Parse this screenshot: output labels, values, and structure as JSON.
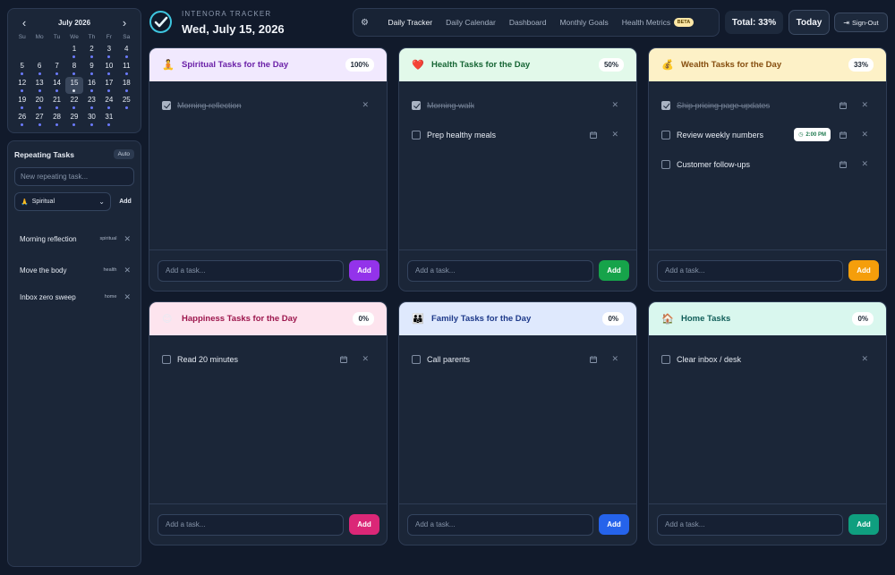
{
  "calendar": {
    "month_label": "July 2026",
    "prev_icon": "chevron-left",
    "next_icon": "chevron-right",
    "weekdays": [
      "Su",
      "Mo",
      "Tu",
      "We",
      "Th",
      "Fr",
      "Sa"
    ],
    "leading_blanks": 3,
    "days": [
      "1",
      "2",
      "3",
      "4",
      "5",
      "6",
      "7",
      "8",
      "9",
      "10",
      "11",
      "12",
      "13",
      "14",
      "15",
      "16",
      "17",
      "18",
      "19",
      "20",
      "21",
      "22",
      "23",
      "24",
      "25",
      "26",
      "27",
      "28",
      "29",
      "30",
      "31"
    ],
    "selected_day": "15"
  },
  "repeating": {
    "title": "Repeating Tasks",
    "auto_label": "Auto",
    "input_placeholder": "New repeating task...",
    "category_select": "Spiritual",
    "category_emoji": "🙏",
    "add_label": "Add",
    "items": [
      {
        "label": "Morning reflection",
        "tag": "spiritual"
      },
      {
        "label": "Move the body",
        "tag": "health"
      },
      {
        "label": "Inbox zero sweep",
        "tag": "home"
      }
    ]
  },
  "brand": {
    "name": "INTENORA TRACKER",
    "date": "Wed, July 15, 2026"
  },
  "nav": {
    "settings_icon": "gear-icon",
    "links": [
      "Daily Tracker",
      "Daily Calendar",
      "Dashboard",
      "Monthly Goals",
      "Health Metrics"
    ],
    "active": "Daily Tracker",
    "beta_label": "BETA"
  },
  "header": {
    "total_label": "Total: 33%",
    "today_label": "Today",
    "signout_label": "Sign-Out"
  },
  "cards": [
    {
      "emoji": "🧘",
      "title": "Spiritual Tasks for the Day",
      "percent": "100%",
      "header_bg": "#f1e9fe",
      "title_color": "#6b21a8",
      "add_color": "#9333ea",
      "placeholder": "Add a task...",
      "add_label": "Add",
      "tasks": [
        {
          "label": "Morning reflection",
          "done": true,
          "calendar": false,
          "time": ""
        }
      ]
    },
    {
      "emoji": "❤️",
      "title": "Health Tasks for the Day",
      "percent": "50%",
      "header_bg": "#e2f9ea",
      "title_color": "#166534",
      "add_color": "#16a34a",
      "placeholder": "Add a task...",
      "add_label": "Add",
      "tasks": [
        {
          "label": "Morning walk",
          "done": true,
          "calendar": false,
          "time": ""
        },
        {
          "label": "Prep healthy meals",
          "done": false,
          "calendar": true,
          "time": ""
        }
      ]
    },
    {
      "emoji": "💰",
      "title": "Wealth Tasks for the Day",
      "percent": "33%",
      "header_bg": "#fdf1c7",
      "title_color": "#854d0e",
      "add_color": "#f59e0b",
      "placeholder": "Add a task...",
      "add_label": "Add",
      "tasks": [
        {
          "label": "Ship pricing page updates",
          "done": true,
          "calendar": true,
          "time": ""
        },
        {
          "label": "Review weekly numbers",
          "done": false,
          "calendar": true,
          "time": "2:00 PM"
        },
        {
          "label": "Customer follow-ups",
          "done": false,
          "calendar": true,
          "time": ""
        }
      ]
    },
    {
      "emoji": "😊",
      "title": "Happiness Tasks for the Day",
      "percent": "0%",
      "header_bg": "#fde4ee",
      "title_color": "#9d174d",
      "add_color": "#db2777",
      "placeholder": "Add a task...",
      "add_label": "Add",
      "tasks": [
        {
          "label": "Read 20 minutes",
          "done": false,
          "calendar": true,
          "time": ""
        }
      ]
    },
    {
      "emoji": "👪",
      "title": "Family Tasks for the Day",
      "percent": "0%",
      "header_bg": "#dfe9fd",
      "title_color": "#1e3a8a",
      "add_color": "#2563eb",
      "placeholder": "Add a task...",
      "add_label": "Add",
      "tasks": [
        {
          "label": "Call parents",
          "done": false,
          "calendar": true,
          "time": ""
        }
      ]
    },
    {
      "emoji": "🏠",
      "title": "Home Tasks",
      "percent": "0%",
      "header_bg": "#d9f7ee",
      "title_color": "#115e59",
      "add_color": "#0f9f7f",
      "placeholder": "Add a task...",
      "add_label": "Add",
      "tasks": [
        {
          "label": "Clear inbox / desk",
          "done": false,
          "calendar": false,
          "time": ""
        }
      ]
    }
  ]
}
